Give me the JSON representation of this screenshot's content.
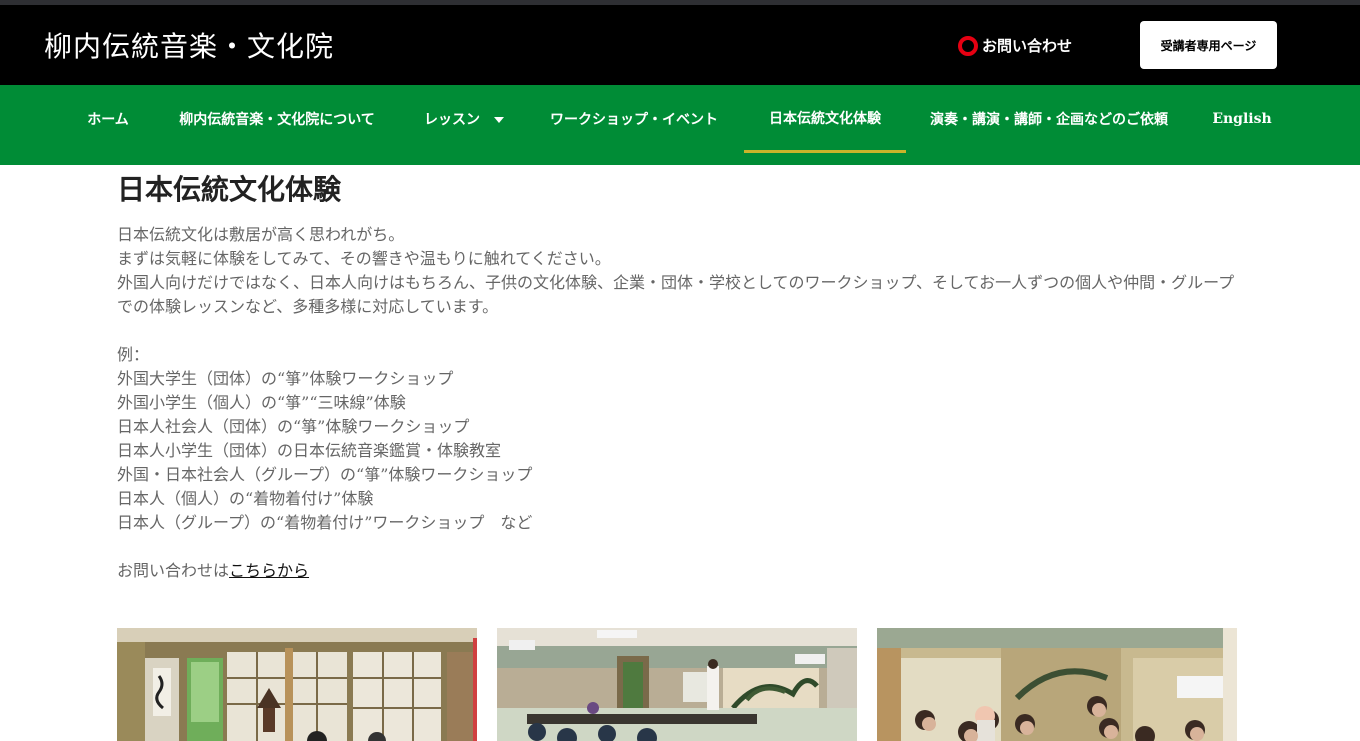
{
  "header": {
    "site_title": "柳内伝統音楽・文化院",
    "contact_label": "お問い合わせ",
    "member_button_label": "受講者専用ページ"
  },
  "nav": {
    "items": [
      {
        "label": "ホーム"
      },
      {
        "label": "柳内伝統音楽・文化院について"
      },
      {
        "label": "レッスン"
      },
      {
        "label": "ワークショップ・イベント"
      },
      {
        "label": "日本伝統文化体験"
      },
      {
        "label": "演奏・講演・講師・企画などのご依頼"
      },
      {
        "label": "English"
      }
    ],
    "active_index": 4,
    "active_color": "#c9b42a",
    "background_color": "#008c36"
  },
  "main": {
    "heading": "日本伝統文化体験",
    "intro_lines": [
      "日本伝統文化は敷居が高く思われがち。",
      "まずは気軽に体験をしてみて、その響きや温もりに触れてください。",
      "外国人向けだけではなく、日本人向けはもちろん、子供の文化体験、企業・団体・学校としてのワークショップ、そしてお一人ずつの個人や仲間・グループ",
      "での体験レッスンなど、多種多様に対応しています。"
    ],
    "examples_label": "例：",
    "examples": [
      "外国大学生（団体）の“箏”体験ワークショップ",
      "外国小学生（個人）の“箏”“三味線”体験",
      "日本人社会人（団体）の“箏”体験ワークショップ",
      "日本人小学生（団体）の日本伝統音楽鑑賞・体験教室",
      "外国・日本社会人（グループ）の“箏”体験ワークショップ",
      "日本人（個人）の“着物着付け”体験",
      "日本人（グループ）の“着物着付け”ワークショップ　など"
    ],
    "contact_prefix": "お問い合わせは",
    "contact_link": "こちらから"
  },
  "photos": [
    {
      "name": "tatami-room-photo"
    },
    {
      "name": "koto-workshop-photo"
    },
    {
      "name": "group-photo"
    }
  ]
}
